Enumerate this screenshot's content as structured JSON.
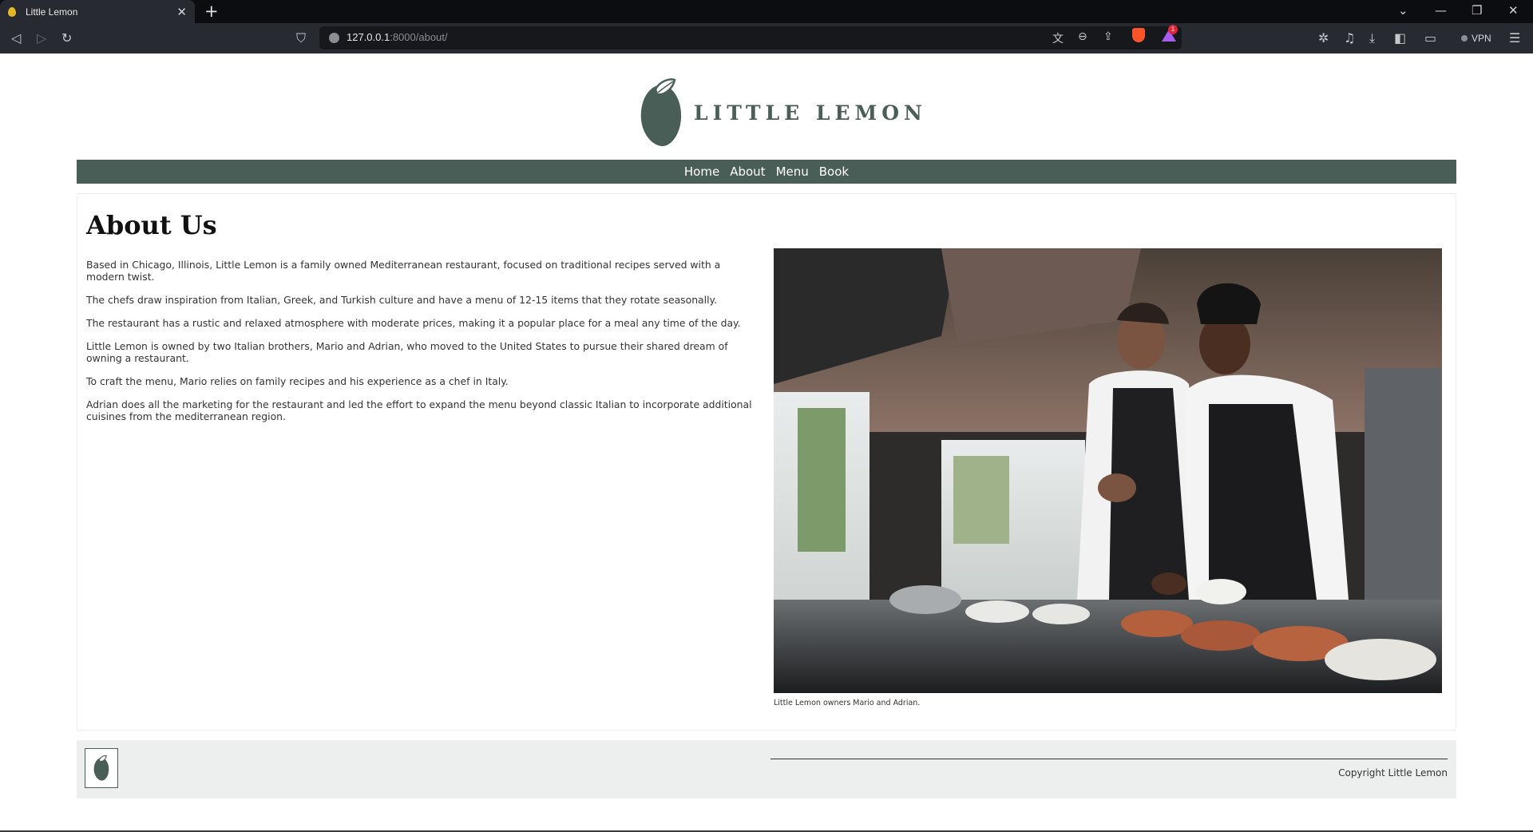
{
  "browser": {
    "tab_title": "Little Lemon",
    "tab_close": "✕",
    "new_tab": "+",
    "url_host": "127.0.0.1",
    "url_rest": ":8000/about/",
    "rewards_badge": "1",
    "vpn_label": "VPN",
    "window_controls": [
      "⌄",
      "—",
      "❐",
      "✕"
    ],
    "icons": {
      "back": "back-icon",
      "forward": "forward-icon",
      "reload": "reload-icon",
      "bookmark": "bookmark-icon",
      "translate": "translate-icon",
      "zoom": "zoom-out-icon",
      "share": "share-icon",
      "brave_shields": "brave-shields-icon",
      "rewards": "brave-rewards-icon",
      "extensions": "extensions-icon",
      "media": "music-icon",
      "downloads": "download-icon",
      "sidebar": "sidebar-icon",
      "wallet": "wallet-icon",
      "menu": "hamburger-menu-icon"
    }
  },
  "header": {
    "logo_text": "LITTLE LEMON",
    "logo_icon": "lemon-logo-icon",
    "logo_color": "#495e57"
  },
  "nav": {
    "items": [
      {
        "label": "Home"
      },
      {
        "label": "About"
      },
      {
        "label": "Menu"
      },
      {
        "label": "Book"
      }
    ],
    "background": "#495e57"
  },
  "about": {
    "title": "About Us",
    "paragraphs": [
      "Based in Chicago, Illinois, Little Lemon is a family owned Mediterranean restaurant, focused on traditional recipes served with a modern twist.",
      "The chefs draw inspiration from Italian, Greek, and Turkish culture and have a menu of 12-15 items that they rotate seasonally.",
      "The restaurant has a rustic and relaxed atmosphere with moderate prices, making it a popular place for a meal any time of the day.",
      "Little Lemon is owned by two Italian brothers, Mario and Adrian, who moved to the United States to pursue their shared dream of owning a restaurant.",
      "To craft the menu, Mario relies on family recipes and his experience as a chef in Italy.",
      "Adrian does all the marketing for the restaurant and led the effort to expand the menu beyond classic Italian to incorporate additional cuisines from the mediterranean region."
    ],
    "image_caption": "Little Lemon owners Mario and Adrian."
  },
  "footer": {
    "logo_icon": "lemon-logo-icon",
    "copyright": "Copyright Little Lemon"
  }
}
